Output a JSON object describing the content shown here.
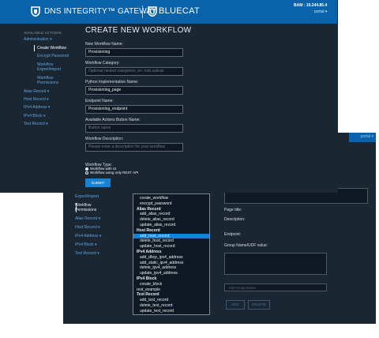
{
  "header": {
    "product_title": "DNS INTEGRITY™ GATEWAY",
    "brand": "BLUECAT",
    "server_label": "BAM :",
    "server_address": "10.244.85.4",
    "username": "portal ▾"
  },
  "sidebar": {
    "heading": "AVAILABLE ACTIONS",
    "items": [
      {
        "label": "Administration ▾",
        "indent": false,
        "active": false
      },
      {
        "label": "Create Workflow",
        "indent": true,
        "active": true
      },
      {
        "label": "Encrypt Password",
        "indent": true,
        "active": false
      },
      {
        "label": "Workflow",
        "indent": true,
        "active": false
      },
      {
        "label": "Export/Import",
        "indent": true,
        "active": false
      },
      {
        "label": "Workflow",
        "indent": true,
        "active": false
      },
      {
        "label": "Permissions",
        "indent": true,
        "active": false
      },
      {
        "label": "Alias Record ▾",
        "indent": false,
        "active": false
      },
      {
        "label": "Host Record ▾",
        "indent": false,
        "active": false
      },
      {
        "label": "IPv4 Address ▾",
        "indent": false,
        "active": false
      },
      {
        "label": "IPv4 Block ▾",
        "indent": false,
        "active": false
      },
      {
        "label": "Text Record ▾",
        "indent": false,
        "active": false
      }
    ]
  },
  "form": {
    "title": "CREATE NEW WORKFLOW",
    "fields": [
      {
        "label": "New Workflow Name:",
        "value": "Provisioning",
        "placeholder": ""
      },
      {
        "label": "Workflow Category:",
        "value": "",
        "placeholder": "Optional nested categories, ex: root.subcat"
      },
      {
        "label": "Python Implementation Name:",
        "value": "Provisioning_page",
        "placeholder": ""
      },
      {
        "label": "Endpoint Name:",
        "value": "Provisioning_endpoint",
        "placeholder": ""
      },
      {
        "label": "Available Actions Button Name:",
        "value": "",
        "placeholder": "Button name"
      },
      {
        "label": "Workflow Description:",
        "value": "",
        "placeholder": "Please enter a description for your workflow"
      }
    ],
    "type_label": "Workflow Type:",
    "type_options": [
      {
        "label": "Workflow with UI",
        "selected": true
      },
      {
        "label": "Workflow using only REST API",
        "selected": false
      }
    ],
    "submit_label": "SUBMIT"
  },
  "back_window": {
    "user": "portal ▾",
    "sidebar": [
      {
        "label": "Export/Import",
        "white": false
      },
      {
        "label": "Workflow",
        "white": true
      },
      {
        "label": "Permissions",
        "white": true
      },
      {
        "label": "Alias Record ▾",
        "white": false
      },
      {
        "label": "Host Record ▾",
        "white": false
      },
      {
        "label": "IPv4 Address ▾",
        "white": false
      },
      {
        "label": "IPv4 Block ▾",
        "white": false
      },
      {
        "label": "Text Record ▾",
        "white": false
      }
    ],
    "workflow_list": [
      {
        "label": "create_workflow",
        "kind": "sub",
        "selected": false
      },
      {
        "label": "encrypt_password",
        "kind": "sub",
        "selected": false
      },
      {
        "label": "Alias Record",
        "kind": "cat",
        "selected": false
      },
      {
        "label": "add_alias_record",
        "kind": "sub",
        "selected": false
      },
      {
        "label": "delete_alias_record",
        "kind": "sub",
        "selected": false
      },
      {
        "label": "update_alias_record",
        "kind": "sub",
        "selected": false
      },
      {
        "label": "Host Record",
        "kind": "cat",
        "selected": false
      },
      {
        "label": "add_host_record",
        "kind": "sub",
        "selected": true
      },
      {
        "label": "delete_host_record",
        "kind": "sub",
        "selected": false
      },
      {
        "label": "update_host_record",
        "kind": "sub",
        "selected": false
      },
      {
        "label": "IPv4 Address",
        "kind": "cat",
        "selected": false
      },
      {
        "label": "add_dhcp_ipv4_address",
        "kind": "sub",
        "selected": false
      },
      {
        "label": "add_static_ipv4_address",
        "kind": "sub",
        "selected": false
      },
      {
        "label": "delete_ipv4_address",
        "kind": "sub",
        "selected": false
      },
      {
        "label": "update_ipv4_address",
        "kind": "sub",
        "selected": false
      },
      {
        "label": "IPv4 Block",
        "kind": "cat",
        "selected": false
      },
      {
        "label": "create_block",
        "kind": "sub",
        "selected": false
      },
      {
        "label": "rest_example",
        "kind": "cat-plain",
        "selected": false
      },
      {
        "label": "Text Record",
        "kind": "cat",
        "selected": false
      },
      {
        "label": "add_text_record",
        "kind": "sub",
        "selected": false
      },
      {
        "label": "delete_text_record",
        "kind": "sub",
        "selected": false
      },
      {
        "label": "update_text_record",
        "kind": "sub",
        "selected": false
      }
    ],
    "page_title_label": "Page title:",
    "description_label": "Description:",
    "endpoint_label": "Endpoint:",
    "group_label": "Group Name/UDF value:",
    "group_placeholder": "Add Group Name",
    "add_label": "ADD",
    "delete_label": "DELETE"
  }
}
